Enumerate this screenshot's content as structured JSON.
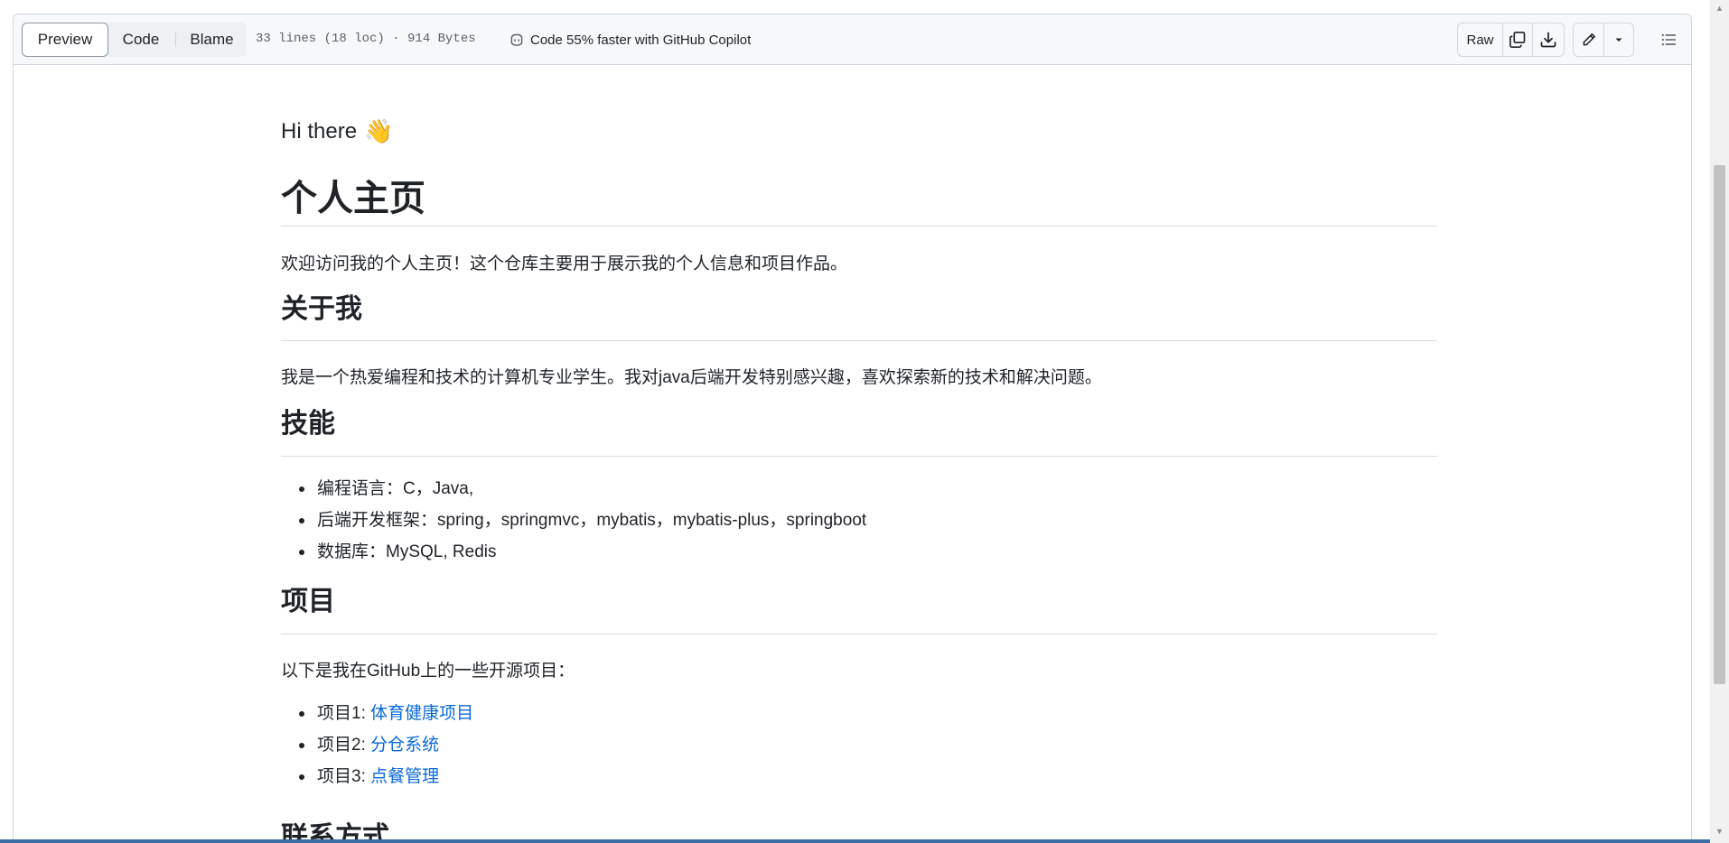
{
  "toolbar": {
    "tabs": [
      {
        "label": "Preview",
        "active": true
      },
      {
        "label": "Code",
        "active": false
      },
      {
        "label": "Blame",
        "active": false
      }
    ],
    "file_meta": "33 lines (18 loc) · 914 Bytes",
    "copilot_label": "Code 55% faster with GitHub Copilot",
    "raw_label": "Raw",
    "icons": [
      "copy-icon",
      "download-icon",
      "pencil-icon",
      "triangle-down-icon",
      "list-unordered-icon"
    ]
  },
  "readme": {
    "greeting": "Hi there",
    "greeting_emoji": "👋",
    "title": "个人主页",
    "intro": "欢迎访问我的个人主页！这个仓库主要用于展示我的个人信息和项目作品。",
    "about": {
      "heading": "关于我",
      "text": "我是一个热爱编程和技术的计算机专业学生。我对java后端开发特别感兴趣，喜欢探索新的技术和解决问题。"
    },
    "skills": {
      "heading": "技能",
      "items": [
        "编程语言：C，Java,",
        "后端开发框架：spring，springmvc，mybatis，mybatis-plus，springboot",
        "数据库：MySQL, Redis"
      ]
    },
    "projects": {
      "heading": "项目",
      "intro": "以下是我在GitHub上的一些开源项目：",
      "items": [
        {
          "prefix": "项目1: ",
          "link": "体育健康项目"
        },
        {
          "prefix": "项目2: ",
          "link": "分仓系统"
        },
        {
          "prefix": "项目3: ",
          "link": "点餐管理"
        }
      ]
    },
    "contact": {
      "heading": "联系方式"
    }
  },
  "colors": {
    "link": "#0969da",
    "text": "#1f2328",
    "border": "#d0d7de",
    "toolbar_bg": "#f6f8fa"
  }
}
